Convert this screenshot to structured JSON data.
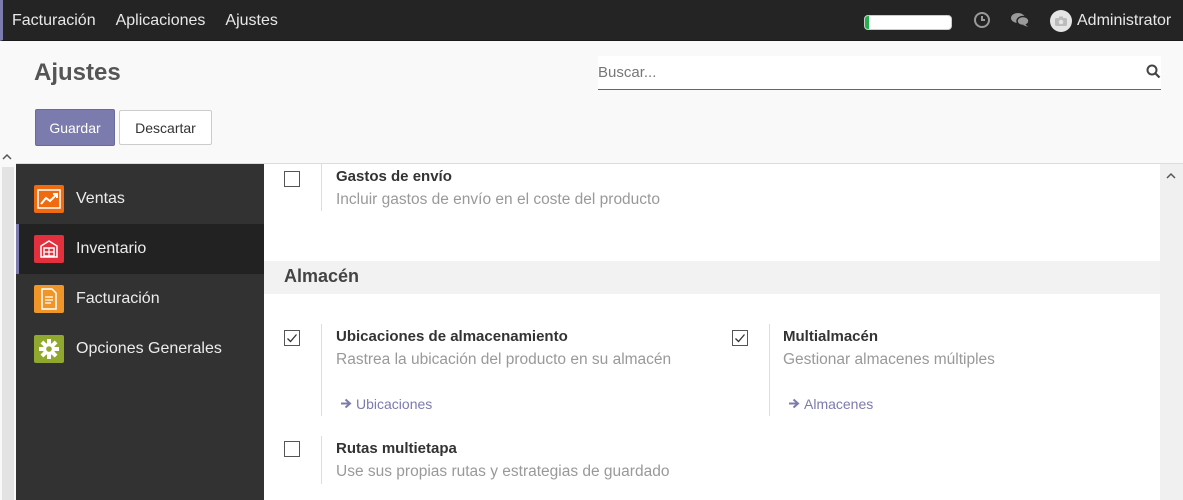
{
  "topbar": {
    "menu": [
      "Facturación",
      "Aplicaciones",
      "Ajustes"
    ],
    "progress": 0.05,
    "progress_color": "#21b04b",
    "icons": [
      "clock-icon",
      "chat-icon",
      "camera-icon"
    ],
    "username": "Administrator"
  },
  "control": {
    "title": "Ajustes",
    "search_placeholder": "Buscar...",
    "save_label": "Guardar",
    "discard_label": "Descartar"
  },
  "sidebar": {
    "items": [
      {
        "label": "Ventas",
        "icon": "sales-chart-icon",
        "color": "#f06b0f"
      },
      {
        "label": "Inventario",
        "icon": "inventory-box-icon",
        "color": "#e3303f",
        "active": true
      },
      {
        "label": "Facturación",
        "icon": "invoice-document-icon",
        "color": "#f09628"
      },
      {
        "label": "Opciones Generales",
        "icon": "gear-icon",
        "color": "#8fa82d"
      }
    ]
  },
  "main": {
    "shipping": {
      "title": "Gastos de envío",
      "desc": "Incluir gastos de envío en el coste del producto",
      "checked": false
    },
    "section_title": "Almacén",
    "locations": {
      "title": "Ubicaciones de almacenamiento",
      "desc": "Rastrea la ubicación del producto en su almacén",
      "link": "Ubicaciones",
      "checked": true
    },
    "multiwarehouse": {
      "title": "Multialmacén",
      "desc": "Gestionar almacenes múltiples",
      "link": "Almacenes",
      "checked": true
    },
    "routes": {
      "title": "Rutas multietapa",
      "desc": "Use sus propias rutas y estrategias de guardado",
      "checked": false
    }
  },
  "colors": {
    "accent": "#7c7bad",
    "navbar": "#242424",
    "sidebar": "#323232"
  }
}
